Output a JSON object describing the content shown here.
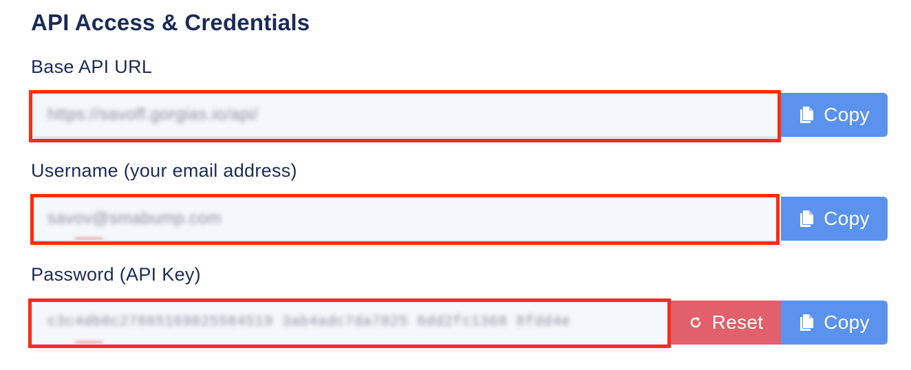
{
  "heading": "API Access & Credentials",
  "fields": {
    "base_url": {
      "label": "Base API URL",
      "value": "https://savoff.gorgias.io/api/",
      "copy_label": "Copy"
    },
    "username": {
      "label": "Username (your email address)",
      "value": "savov@smabump.com",
      "copy_label": "Copy"
    },
    "password": {
      "label": "Password (API Key)",
      "value": "c3c4db8c27865169825584519 3ab4adc7da7825 6dd2fc1368 8fdd4e",
      "reset_label": "Reset",
      "copy_label": "Copy"
    }
  },
  "colors": {
    "primary": "#5b92ee",
    "danger": "#e1606b",
    "heading_text": "#1b2a57",
    "annotation_highlight": "#ff2a10"
  },
  "icons": {
    "copy": "copy-icon",
    "reset": "refresh-icon"
  }
}
